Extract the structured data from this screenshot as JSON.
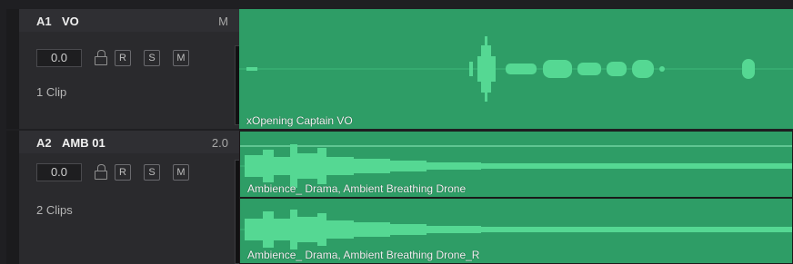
{
  "tracks": [
    {
      "id": "A1",
      "name": "VO",
      "channel": "M",
      "volume": "0.0",
      "buttons": [
        "R",
        "S",
        "M"
      ],
      "clip_count": "1 Clip",
      "clips": [
        {
          "label": "xOpening Captain VO",
          "color": "#2e9d66"
        }
      ]
    },
    {
      "id": "A2",
      "name": "AMB 01",
      "channel": "2.0",
      "volume": "0.0",
      "buttons": [
        "R",
        "S",
        "M"
      ],
      "clip_count": "2 Clips",
      "clips": [
        {
          "label": "Ambience_ Drama, Ambient Breathing Drone",
          "color": "#2e9d66"
        },
        {
          "label": "Ambience_ Drama, Ambient Breathing Drone_R",
          "color": "#2e9d66"
        }
      ]
    }
  ],
  "colors": {
    "clip_green": "#2e9d66",
    "waveform": "#4fd58e",
    "header_bg": "#2a2a2d"
  },
  "icons": {
    "lock": "lock-icon"
  }
}
